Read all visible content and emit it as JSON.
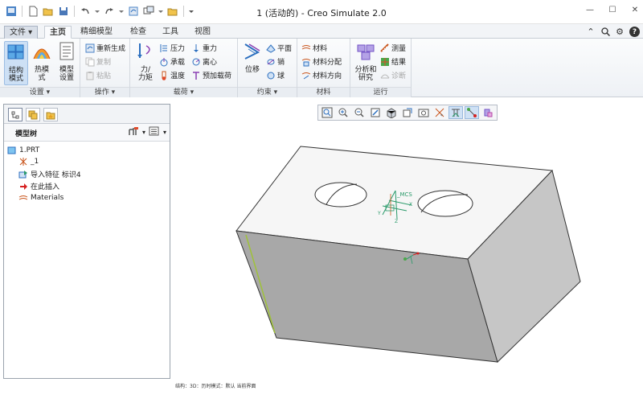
{
  "window": {
    "title": "1 (活动的) - Creo Simulate 2.0"
  },
  "tabs": {
    "file": "文件",
    "items": [
      "主页",
      "精细模型",
      "检查",
      "工具",
      "视图"
    ],
    "active": "主页"
  },
  "ribbon": {
    "setup": {
      "label": "设置",
      "structure_mode_line1": "结构",
      "structure_mode_line2": "模式",
      "thermal_mode_line1": "热模",
      "thermal_mode_line2": "式",
      "model_setup_line1": "模型",
      "model_setup_line2": "设置"
    },
    "operations": {
      "label": "操作",
      "regenerate": "重新生成",
      "copy": "复制",
      "paste": "粘贴"
    },
    "loads": {
      "label": "载荷",
      "force_line1": "力/",
      "force_line2": "力矩",
      "pressure": "压力",
      "bearing": "承载",
      "temperature": "温度",
      "gravity": "重力",
      "centrifugal": "离心",
      "preload": "预加载荷"
    },
    "constraints": {
      "label": "约束",
      "displacement": "位移",
      "plane": "平面",
      "pin": "销",
      "ball": "球"
    },
    "materials": {
      "label": "材料",
      "material": "材料",
      "assignment": "材料分配",
      "orientation": "材料方向"
    },
    "run": {
      "label": "运行",
      "analysis_line1": "分析和",
      "analysis_line2": "研究",
      "measure": "测量",
      "results": "结果",
      "diagnostics": "诊断"
    }
  },
  "model_tree": {
    "title": "模型树",
    "nodes": [
      "1.PRT",
      "_1",
      "导入特征 标识4",
      "在此插入",
      "Materials"
    ]
  },
  "graphics": {
    "csys_label": "_MCS",
    "x_label": "X",
    "y_label": "Y",
    "z_label": "Z"
  },
  "status": "结构：3D：历时模式：默认 当前界面",
  "colors": {
    "accent": "#2c6fbf",
    "block_top": "#f6f6f6",
    "block_front": "#a8a8a8",
    "block_side": "#c6c6c6",
    "edge_highlight": "#9fc23a",
    "csys": "#2a9a6a"
  }
}
